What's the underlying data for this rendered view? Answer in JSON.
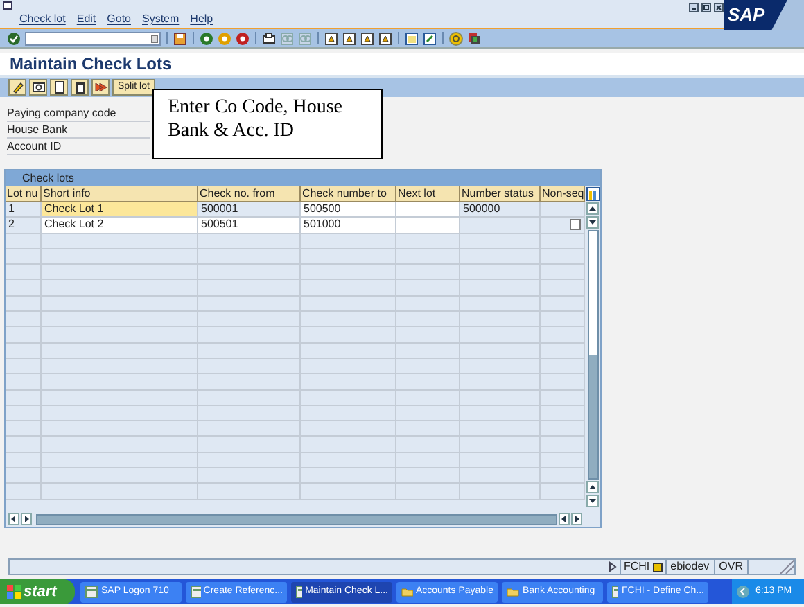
{
  "logo": "SAP",
  "menu": [
    {
      "label": "Check lot"
    },
    {
      "label": "Edit"
    },
    {
      "label": "Goto"
    },
    {
      "label": "System"
    },
    {
      "label": "Help"
    }
  ],
  "title": "Maintain Check Lots",
  "app_toolbar": {
    "button": "Split lot"
  },
  "fields": [
    {
      "label": "Paying company code"
    },
    {
      "label": "House Bank"
    },
    {
      "label": "Account ID"
    }
  ],
  "callout": "Enter Co Code, House Bank & Acc. ID",
  "table": {
    "title": "Check lots",
    "columns": [
      "Lot nu",
      "Short info",
      "Check no. from",
      "Check number to",
      "Next lot",
      "Number status",
      "Non-seq"
    ],
    "rows": [
      {
        "selected": true,
        "cells": [
          {
            "text": "1",
            "editable": false
          },
          {
            "text": "Check Lot 1",
            "editable": true
          },
          {
            "text": "500001",
            "editable": false
          },
          {
            "text": "500500",
            "editable": true
          },
          {
            "text": "",
            "editable": true
          },
          {
            "text": "500000",
            "editable": false
          },
          {
            "kind": "empty",
            "editable": false
          }
        ]
      },
      {
        "selected": false,
        "cells": [
          {
            "text": "2",
            "editable": false
          },
          {
            "text": "Check Lot 2",
            "editable": true
          },
          {
            "text": "500501",
            "editable": true
          },
          {
            "text": "501000",
            "editable": true
          },
          {
            "text": "",
            "editable": true
          },
          {
            "text": "",
            "editable": false
          },
          {
            "kind": "checkbox",
            "checked": false,
            "editable": false
          }
        ]
      }
    ]
  },
  "status_bar": {
    "transaction": "FCHI",
    "system": "ebiodev",
    "mode": "OVR"
  },
  "taskbar": {
    "start": "start",
    "items": [
      {
        "label": "SAP Logon 710",
        "selected": false
      },
      {
        "label": "Create Referenc...",
        "selected": false
      },
      {
        "label": "Maintain Check L...",
        "selected": true
      },
      {
        "label": "Accounts Payable",
        "selected": false
      },
      {
        "label": "Bank Accounting",
        "selected": false
      },
      {
        "label": "FCHI - Define Ch...",
        "selected": false
      }
    ],
    "clock": "6:13 PM"
  }
}
